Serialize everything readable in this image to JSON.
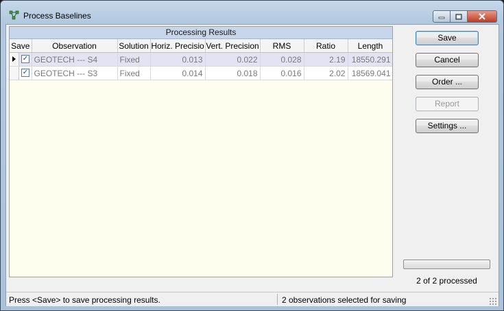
{
  "window": {
    "title": "Process Baselines",
    "icon": "baseline-network-icon",
    "controls": {
      "minimize": "minimize-icon",
      "maximize": "maximize-icon",
      "close": "close-icon"
    }
  },
  "grid": {
    "group_header": "Processing Results",
    "columns": [
      "Save",
      "Observation",
      "Solution",
      "Horiz. Precisio",
      "Vert. Precision",
      "RMS",
      "Ratio",
      "Length"
    ],
    "rows": [
      {
        "save": true,
        "observation": "GEOTECH --- S4",
        "solution": "Fixed",
        "horiz": "0.013",
        "vert": "0.022",
        "rms": "0.028",
        "ratio": "2.19",
        "length": "18550.291",
        "current": true
      },
      {
        "save": true,
        "observation": "GEOTECH --- S3",
        "solution": "Fixed",
        "horiz": "0.014",
        "vert": "0.018",
        "rms": "0.016",
        "ratio": "2.02",
        "length": "18569.041",
        "current": false
      }
    ]
  },
  "buttons": {
    "save": "Save",
    "cancel": "Cancel",
    "order": "Order ...",
    "report": "Report",
    "settings": "Settings ..."
  },
  "progress": {
    "fraction": 0,
    "text": "2 of 2 processed"
  },
  "status": {
    "left": "Press <Save> to save processing results.",
    "right": "2 observations selected for saving"
  },
  "colors": {
    "grid_background": "#fefeee",
    "selected_row": "#e3e3f4",
    "header": "#c7d6e9"
  }
}
